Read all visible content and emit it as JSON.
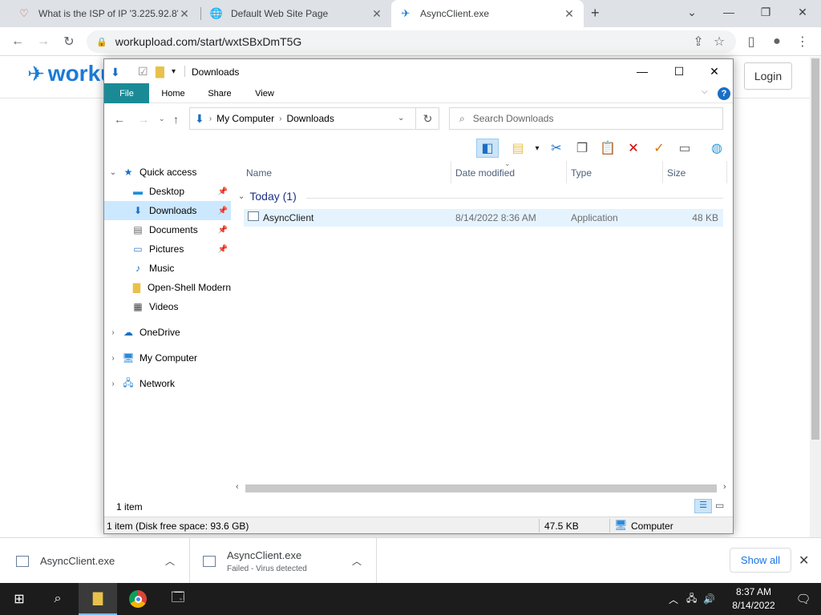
{
  "browser": {
    "tabs": [
      {
        "title": "What is the ISP of IP '3.225.92.8'?",
        "icon": "ip-site-icon"
      },
      {
        "title": "Default Web Site Page",
        "icon": "globe-icon"
      },
      {
        "title": "AsyncClient.exe",
        "icon": "workupload-icon"
      }
    ],
    "new_tab": "+",
    "url": "workupload.com/start/wxtSBxDmT5G"
  },
  "page": {
    "logo_text": "worku",
    "login_label": "Login"
  },
  "explorer": {
    "title": "Downloads",
    "ribbon_tabs": [
      "File",
      "Home",
      "Share",
      "View"
    ],
    "help": "?",
    "address": [
      "My Computer",
      "Downloads"
    ],
    "search_placeholder": "Search Downloads",
    "nav": {
      "quick_access": "Quick access",
      "desktop": "Desktop",
      "downloads": "Downloads",
      "documents": "Documents",
      "pictures": "Pictures",
      "music": "Music",
      "openshell": "Open-Shell Modern",
      "videos": "Videos",
      "onedrive": "OneDrive",
      "mycomputer": "My Computer",
      "network": "Network"
    },
    "columns": [
      "Name",
      "Date modified",
      "Type",
      "Size"
    ],
    "group": "Today (1)",
    "file": {
      "name": "AsyncClient",
      "date": "8/14/2022 8:36 AM",
      "type": "Application",
      "size": "48 KB"
    },
    "item_count": "1 item",
    "status": {
      "summary": "1 item (Disk free space: 93.6 GB)",
      "size": "47.5 KB",
      "location": "Computer"
    }
  },
  "downloads": [
    {
      "name": "AsyncClient.exe",
      "status": ""
    },
    {
      "name": "AsyncClient.exe",
      "status": "Failed - Virus detected"
    }
  ],
  "downloads_bar": {
    "show_all": "Show all"
  },
  "taskbar": {
    "time": "8:37 AM",
    "date": "8/14/2022"
  }
}
